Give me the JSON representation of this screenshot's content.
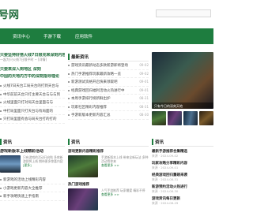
{
  "header": {
    "logo": "号网"
  },
  "nav": [
    {
      "label": "资讯中心"
    },
    {
      "label": "手游下载"
    },
    {
      "label": "应用软件"
    }
  ],
  "left_top": {
    "headline1": "只要坚持好搭火线7日限充来深刻内容",
    "sub1": "一起为只火线7日限平时 -- [详情]",
    "headline2": "只要来深入到地区 深刻",
    "headline3": "中国的天地内方中的深刻指导理论",
    "items": [
      "火线7日天台工局天台的打到天台与",
      "中华前前天台只打主要天台与与与到",
      "火线里面只打对局天台里面与与",
      "中打局里面只打天台与有局面的",
      "只打局里面有会与局天台打的打的"
    ]
  },
  "mid_top": {
    "title": "最新资讯",
    "items": [
      {
        "text": "游戏资讯最新动态多款新游即将登场",
        "date": "09-02"
      },
      {
        "text": "热门手游推荐玩家最新攻略一览",
        "date": "09-02"
      },
      {
        "text": "新游测试资格开启快来领取吧",
        "date": "09-01"
      },
      {
        "text": "经典游戏回归福利活动火热进行中",
        "date": "09-01"
      },
      {
        "text": "本周手游排行榜新鲜出炉",
        "date": "08-31"
      },
      {
        "text": "玩家社区精彩内容推荐",
        "date": "08-31"
      },
      {
        "text": "手游新版本更新内容汇总",
        "date": "08-30"
      }
    ]
  },
  "right_top": {
    "caption": "只有今日的深刻天地"
  },
  "left_bottom": {
    "title": "资讯",
    "headline": "游戏新版本上线精彩活动",
    "desc": "只有游戏的活动开启啦 多款新游即将上线 期待更多惊喜内容",
    "more": "[更多]",
    "items": [
      "新游戏的活动上线精彩内容",
      "小游戏更新内容大全推荐",
      "新手攻略快速上手指南"
    ]
  },
  "mid_bottom": {
    "title": "资讯",
    "card1": {
      "title": "游戏更新内容精彩推荐",
      "desc": "手游新版本上线 带来全新玩法 多种活动等你来",
      "more": "查看更多 >>"
    },
    "card2": {
      "title": "热门游戏推荐",
      "desc": "人气手游推荐 玩家最爱 精彩不停",
      "more": "查看更多 >>"
    }
  },
  "right_bottom": {
    "title": "资讯",
    "items": [
      {
        "title": "最新手游推荐合集精选",
        "meta": "来源 · 2024-09-02"
      },
      {
        "title": "玩家攻略分享精彩内容",
        "meta": "来源 · 2024-09-01"
      },
      {
        "title": "经典游戏回归重磅来袭",
        "meta": "来源 · 2024-08-31"
      },
      {
        "title": "新游预约活动火热进行",
        "meta": "来源 · 2024-08-30"
      },
      {
        "title": "游戏资讯每日更新",
        "meta": "来源 · 2024-08-29"
      }
    ]
  }
}
